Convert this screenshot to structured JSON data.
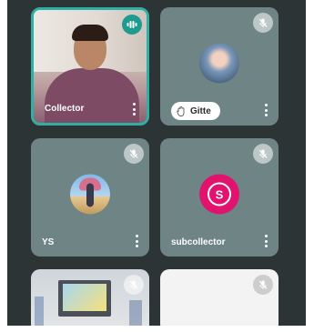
{
  "participants": [
    {
      "name": "Collector",
      "status": "speaking"
    },
    {
      "name": "Gitte",
      "status": "muted",
      "hand_raised": true
    },
    {
      "name": "YS",
      "status": "muted"
    },
    {
      "name": "subcollector",
      "status": "muted",
      "initial": "S"
    },
    {
      "name": "",
      "status": "muted"
    },
    {
      "name": "",
      "status": "muted"
    }
  ],
  "colors": {
    "background": "#2d3436",
    "tile": "#6e8485",
    "active_border": "#2fb0a4",
    "speaking_badge": "#1f9a8e",
    "avatar_s": "#e2136e"
  },
  "icons": {
    "speaking": "audio-wave-icon",
    "muted": "mic-off-icon",
    "menu": "more-vertical-icon",
    "hand": "hand-raised-icon"
  }
}
